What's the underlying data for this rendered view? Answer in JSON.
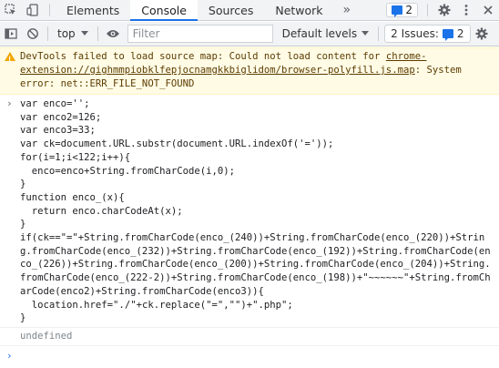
{
  "tabs": [
    {
      "label": "Elements"
    },
    {
      "label": "Console"
    },
    {
      "label": "Sources"
    },
    {
      "label": "Network"
    }
  ],
  "tabs_more": "»",
  "messages_badge": {
    "count": "2"
  },
  "toolbar": {
    "context": "top",
    "filter_placeholder": "Filter",
    "levels_label": "Default levels",
    "issues_label": "2 Issues:",
    "issues_count": "2"
  },
  "console": {
    "warning": {
      "prefix": "DevTools failed to load source map: Could not load content for ",
      "link": "chrome-extension://gighmmpiobklfepjocnamgkkbiglidom/browser-polyfill.js.map",
      "suffix": ": System error: net::ERR_FILE_NOT_FOUND"
    },
    "code": "var enco='';\nvar enco2=126;\nvar enco3=33;\nvar ck=document.URL.substr(document.URL.indexOf('='));\nfor(i=1;i<122;i++){\n  enco=enco+String.fromCharCode(i,0);\n}\nfunction enco_(x){\n  return enco.charCodeAt(x);\n}\nif(ck==\"=\"+String.fromCharCode(enco_(240))+String.fromCharCode(enco_(220))+String.fromCharCode(enco_(232))+String.fromCharCode(enco_(192))+String.fromCharCode(enco_(226))+String.fromCharCode(enco_(200))+String.fromCharCode(enco_(204))+String.fromCharCode(enco_(222-2))+String.fromCharCode(enco_(198))+\"~~~~~~\"+String.fromCharCode(enco2)+String.fromCharCode(enco3)){\n  location.href=\"./\"+ck.replace(\"=\",\"\")+\".php\";\n}",
    "result": "undefined"
  },
  "colors": {
    "accent": "#1a73e8",
    "warning_bg": "#fffbe5",
    "warning_text": "#5c3c00"
  },
  "icons": [
    "inspect-icon",
    "device-toolbar-icon",
    "settings-gear-icon",
    "more-vert-icon",
    "close-icon",
    "sidebar-toggle-icon",
    "clear-console-icon",
    "eye-icon",
    "console-settings-icon",
    "warning-icon"
  ]
}
